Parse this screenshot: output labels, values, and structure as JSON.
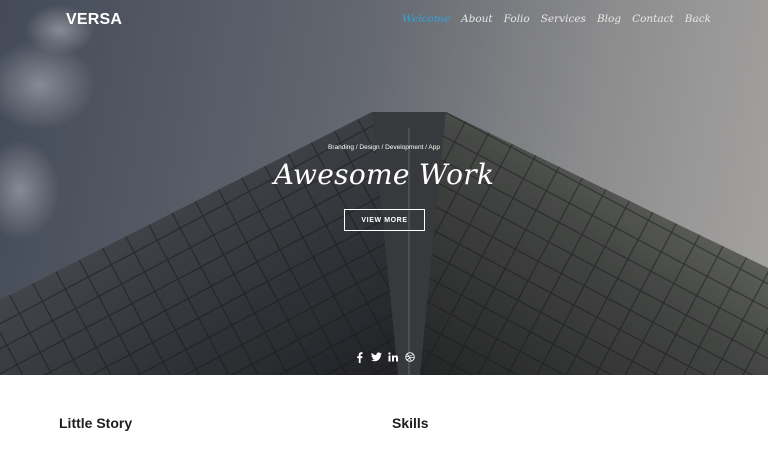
{
  "brand": {
    "logo": "VERSA"
  },
  "nav": {
    "items": [
      {
        "label": "Welcome",
        "active": true
      },
      {
        "label": "About",
        "active": false
      },
      {
        "label": "Folio",
        "active": false
      },
      {
        "label": "Services",
        "active": false
      },
      {
        "label": "Blog",
        "active": false
      },
      {
        "label": "Contact",
        "active": false
      },
      {
        "label": "Back",
        "active": false
      }
    ],
    "active_color": "#35a3d8"
  },
  "hero": {
    "tagline": "Branding / Design / Development / App",
    "headline": "Awesome Work",
    "cta_label": "VIEW MORE",
    "social_icons": [
      "facebook-icon",
      "twitter-icon",
      "linkedin-icon",
      "dribbble-icon"
    ]
  },
  "sections": {
    "story_title": "Little Story",
    "skills_title": "Skills"
  }
}
